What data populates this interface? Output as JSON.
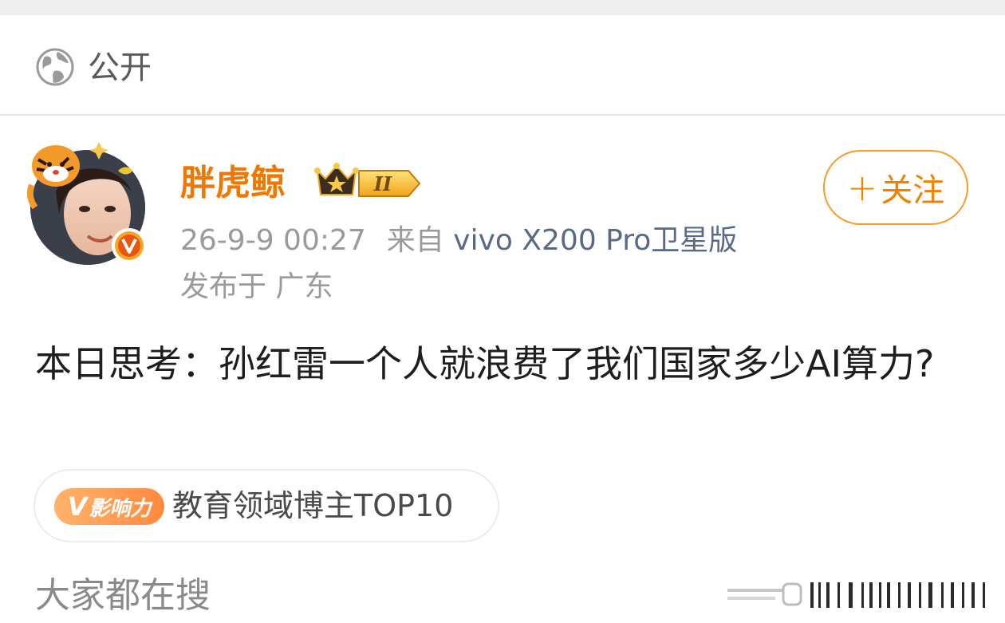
{
  "visibility": {
    "label": "公开",
    "icon": "globe-icon"
  },
  "post": {
    "author": {
      "name": "胖虎鲸",
      "level_badge": "II",
      "verified_icon": "verified-v-icon"
    },
    "follow_button": {
      "plus": "+",
      "label": "关注"
    },
    "meta": {
      "time": "26-9-9 00:27",
      "source_label": "来自",
      "device": "vivo X200 Pro卫星版",
      "location": "发布于 广东"
    },
    "text": "本日思考：孙红雷一个人就浪费了我们国家多少AI算力?",
    "influence": {
      "badge_v": "V",
      "badge_text": "影响力",
      "label": "教育领域博主TOP10"
    }
  },
  "trending": {
    "title": "大家都在搜"
  },
  "colors": {
    "accent_orange": "#f07800",
    "follow_border": "#f59b2a",
    "device_link": "#5a6a86"
  }
}
